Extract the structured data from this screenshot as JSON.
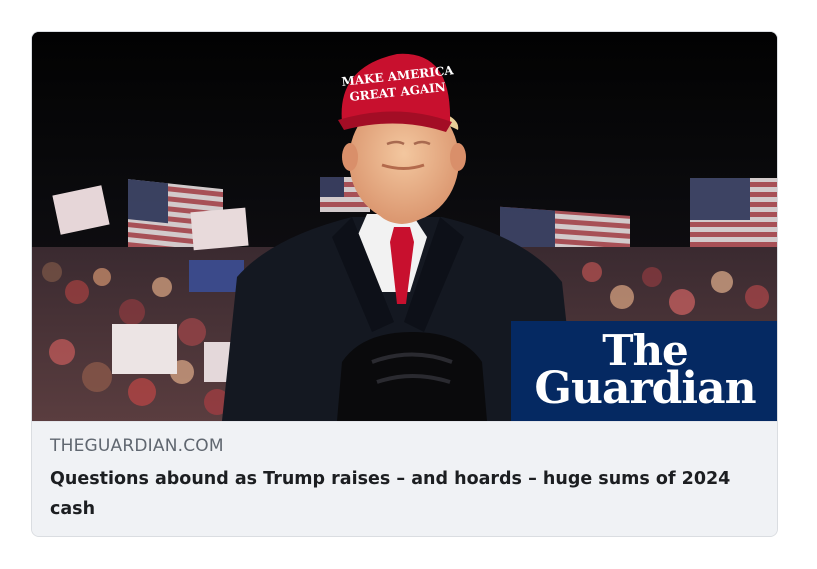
{
  "link_preview": {
    "domain": "THEGUARDIAN.COM",
    "headline": "Questions abound as Trump raises – and hoards – huge sums of 2024 cash",
    "image": {
      "hat_text_line1": "MAKE AMERICA",
      "hat_text_line2": "GREAT AGAIN",
      "logo_line1": "The",
      "logo_line2": "Guardian"
    }
  },
  "colors": {
    "card_background": "#f0f2f5",
    "domain_text": "#606770",
    "headline_text": "#1c1e21",
    "guardian_blue": "#052962",
    "hat_red": "#c8102e"
  }
}
